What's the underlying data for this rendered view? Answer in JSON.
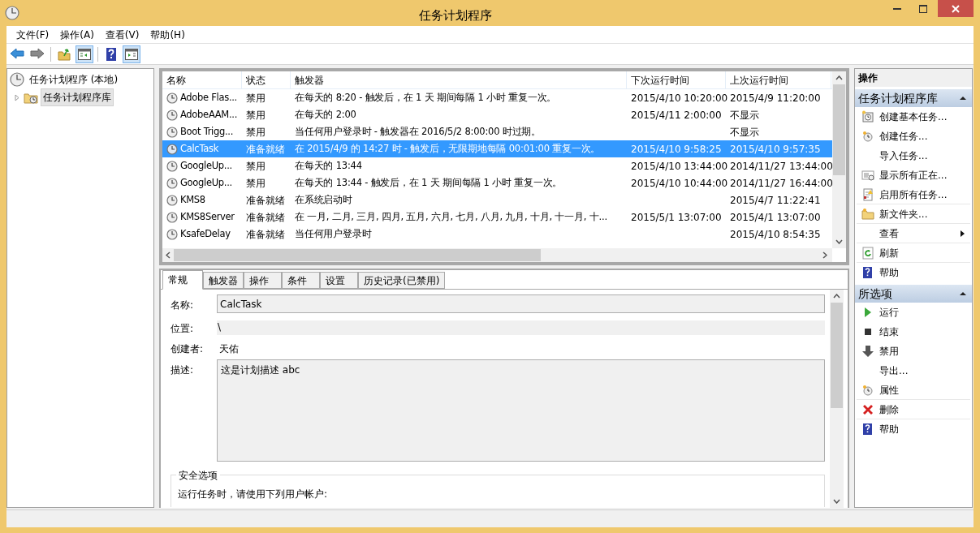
{
  "window": {
    "title": "任务计划程序"
  },
  "menu": [
    "文件(F)",
    "操作(A)",
    "查看(V)",
    "帮助(H)"
  ],
  "toolbar": [
    {
      "kind": "back",
      "pressed": false
    },
    {
      "kind": "forward",
      "pressed": false
    },
    {
      "kind": "separator"
    },
    {
      "kind": "up",
      "pressed": false
    },
    {
      "kind": "tree",
      "pressed": true
    },
    {
      "kind": "separator"
    },
    {
      "kind": "help",
      "pressed": false
    },
    {
      "kind": "actions",
      "pressed": true
    }
  ],
  "tree": [
    {
      "label": "任务计划程序 (本地)",
      "selected": false,
      "children": [
        {
          "label": "任务计划程序库",
          "selected": true,
          "expanded": false
        }
      ]
    }
  ],
  "table": {
    "columns": [
      "名称",
      "状态",
      "触发器",
      "下次运行时间",
      "上次运行时间"
    ],
    "rows": [
      {
        "name": "Adobe Flas...",
        "status": "禁用",
        "trigger": "在每天的 8:20 - 触发后，在 1 天 期间每隔 1 小时 重复一次。",
        "next_run": "2015/4/10 10:20:00",
        "last_run": "2015/4/9 11:20:00",
        "selected": false
      },
      {
        "name": "AdobeAAM...",
        "status": "禁用",
        "trigger": "在每天的 2:00",
        "next_run": "2015/4/11 2:00:00",
        "last_run": "不显示",
        "selected": false
      },
      {
        "name": "Boot Trigg...",
        "status": "禁用",
        "trigger": "当任何用户登录时 - 触发器在 2016/5/2 8:00:00 时过期。",
        "next_run": "",
        "last_run": "不显示",
        "selected": false
      },
      {
        "name": "CalcTask",
        "status": "准备就绪",
        "trigger": "在 2015/4/9 的 14:27 时 - 触发后，无限期地每隔 00:01:00 重复一次。",
        "next_run": "2015/4/10 9:58:25",
        "last_run": "2015/4/10 9:57:35",
        "selected": true
      },
      {
        "name": "GoogleUp...",
        "status": "禁用",
        "trigger": "在每天的 13:44",
        "next_run": "2015/4/10 13:44:00",
        "last_run": "2014/11/27 13:44:00",
        "selected": false
      },
      {
        "name": "GoogleUp...",
        "status": "禁用",
        "trigger": "在每天的 13:44 - 触发后，在 1 天 期间每隔 1 小时 重复一次。",
        "next_run": "2015/4/10 10:44:00",
        "last_run": "2014/11/27 16:44:00",
        "selected": false
      },
      {
        "name": "KMS8",
        "status": "准备就绪",
        "trigger": "在系统启动时",
        "next_run": "",
        "last_run": "2015/4/7 11:22:41",
        "selected": false
      },
      {
        "name": "KMS8Server",
        "status": "准备就绪",
        "trigger": "在 一月, 二月, 三月, 四月, 五月, 六月, 七月, 八月, 九月, 十月, 十一月, 十...",
        "next_run": "2015/5/1 13:07:00",
        "last_run": "2015/4/1 13:07:00",
        "selected": false
      },
      {
        "name": "KsafeDelay",
        "status": "准备就绪",
        "trigger": "当任何用户登录时",
        "next_run": "",
        "last_run": "2015/4/10 8:54:35",
        "selected": false
      }
    ]
  },
  "details": {
    "tabs": [
      {
        "label": "常规",
        "selected": true
      },
      {
        "label": "触发器",
        "selected": false
      },
      {
        "label": "操作",
        "selected": false
      },
      {
        "label": "条件",
        "selected": false
      },
      {
        "label": "设置",
        "selected": false
      },
      {
        "label": "历史记录(已禁用)",
        "selected": false
      }
    ],
    "name_label": "名称:",
    "name_value": "CalcTask",
    "location_label": "位置:",
    "location_value": "\\",
    "author_label": "创建者:",
    "author_value": "天佑",
    "description_label": "描述:",
    "description_value": "这是计划描述 abc",
    "security_title": "安全选项",
    "security_text": "运行任务时，请使用下列用户帐户:"
  },
  "actions": {
    "header": "操作",
    "sections": [
      {
        "title": "任务计划程序库",
        "expanded": true,
        "items": [
          {
            "label": "创建基本任务...",
            "kind": "wizard",
            "submenu": false,
            "divider": false
          },
          {
            "label": "创建任务...",
            "kind": "clock",
            "submenu": false,
            "divider": false
          },
          {
            "label": "导入任务...",
            "kind": "plain",
            "submenu": false,
            "divider": false
          },
          {
            "label": "显示所有正在...",
            "kind": "list",
            "submenu": false,
            "divider": false
          },
          {
            "label": "启用所有任务...",
            "kind": "log",
            "submenu": false,
            "divider": true
          },
          {
            "label": "新文件夹...",
            "kind": "folder",
            "submenu": false,
            "divider": true
          },
          {
            "label": "查看",
            "kind": "plain",
            "submenu": true,
            "divider": true
          },
          {
            "label": "刷新",
            "kind": "refresh",
            "submenu": false,
            "divider": true
          },
          {
            "label": "帮助",
            "kind": "help",
            "submenu": false,
            "divider": false
          }
        ]
      },
      {
        "title": "所选项",
        "expanded": true,
        "items": [
          {
            "label": "运行",
            "kind": "run",
            "submenu": false,
            "divider": false
          },
          {
            "label": "结束",
            "kind": "stop",
            "submenu": false,
            "divider": false
          },
          {
            "label": "禁用",
            "kind": "down",
            "submenu": false,
            "divider": false
          },
          {
            "label": "导出...",
            "kind": "plain",
            "submenu": false,
            "divider": false
          },
          {
            "label": "属性",
            "kind": "clock",
            "submenu": false,
            "divider": true
          },
          {
            "label": "删除",
            "kind": "delete",
            "submenu": false,
            "divider": true
          },
          {
            "label": "帮助",
            "kind": "help",
            "submenu": false,
            "divider": false
          }
        ]
      }
    ]
  }
}
